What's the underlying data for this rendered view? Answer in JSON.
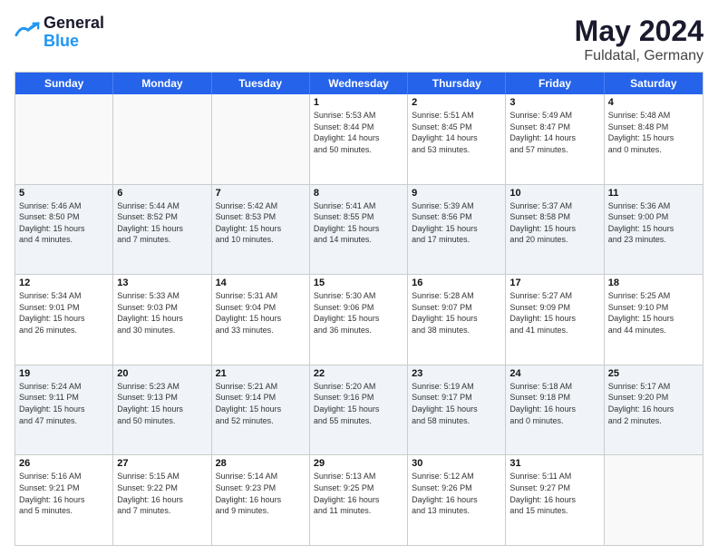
{
  "logo": {
    "line1": "General",
    "line2": "Blue"
  },
  "title": "May 2024",
  "subtitle": "Fuldatal, Germany",
  "dayHeaders": [
    "Sunday",
    "Monday",
    "Tuesday",
    "Wednesday",
    "Thursday",
    "Friday",
    "Saturday"
  ],
  "weeks": [
    [
      {
        "day": "",
        "info": ""
      },
      {
        "day": "",
        "info": ""
      },
      {
        "day": "",
        "info": ""
      },
      {
        "day": "1",
        "info": "Sunrise: 5:53 AM\nSunset: 8:44 PM\nDaylight: 14 hours\nand 50 minutes."
      },
      {
        "day": "2",
        "info": "Sunrise: 5:51 AM\nSunset: 8:45 PM\nDaylight: 14 hours\nand 53 minutes."
      },
      {
        "day": "3",
        "info": "Sunrise: 5:49 AM\nSunset: 8:47 PM\nDaylight: 14 hours\nand 57 minutes."
      },
      {
        "day": "4",
        "info": "Sunrise: 5:48 AM\nSunset: 8:48 PM\nDaylight: 15 hours\nand 0 minutes."
      }
    ],
    [
      {
        "day": "5",
        "info": "Sunrise: 5:46 AM\nSunset: 8:50 PM\nDaylight: 15 hours\nand 4 minutes."
      },
      {
        "day": "6",
        "info": "Sunrise: 5:44 AM\nSunset: 8:52 PM\nDaylight: 15 hours\nand 7 minutes."
      },
      {
        "day": "7",
        "info": "Sunrise: 5:42 AM\nSunset: 8:53 PM\nDaylight: 15 hours\nand 10 minutes."
      },
      {
        "day": "8",
        "info": "Sunrise: 5:41 AM\nSunset: 8:55 PM\nDaylight: 15 hours\nand 14 minutes."
      },
      {
        "day": "9",
        "info": "Sunrise: 5:39 AM\nSunset: 8:56 PM\nDaylight: 15 hours\nand 17 minutes."
      },
      {
        "day": "10",
        "info": "Sunrise: 5:37 AM\nSunset: 8:58 PM\nDaylight: 15 hours\nand 20 minutes."
      },
      {
        "day": "11",
        "info": "Sunrise: 5:36 AM\nSunset: 9:00 PM\nDaylight: 15 hours\nand 23 minutes."
      }
    ],
    [
      {
        "day": "12",
        "info": "Sunrise: 5:34 AM\nSunset: 9:01 PM\nDaylight: 15 hours\nand 26 minutes."
      },
      {
        "day": "13",
        "info": "Sunrise: 5:33 AM\nSunset: 9:03 PM\nDaylight: 15 hours\nand 30 minutes."
      },
      {
        "day": "14",
        "info": "Sunrise: 5:31 AM\nSunset: 9:04 PM\nDaylight: 15 hours\nand 33 minutes."
      },
      {
        "day": "15",
        "info": "Sunrise: 5:30 AM\nSunset: 9:06 PM\nDaylight: 15 hours\nand 36 minutes."
      },
      {
        "day": "16",
        "info": "Sunrise: 5:28 AM\nSunset: 9:07 PM\nDaylight: 15 hours\nand 38 minutes."
      },
      {
        "day": "17",
        "info": "Sunrise: 5:27 AM\nSunset: 9:09 PM\nDaylight: 15 hours\nand 41 minutes."
      },
      {
        "day": "18",
        "info": "Sunrise: 5:25 AM\nSunset: 9:10 PM\nDaylight: 15 hours\nand 44 minutes."
      }
    ],
    [
      {
        "day": "19",
        "info": "Sunrise: 5:24 AM\nSunset: 9:11 PM\nDaylight: 15 hours\nand 47 minutes."
      },
      {
        "day": "20",
        "info": "Sunrise: 5:23 AM\nSunset: 9:13 PM\nDaylight: 15 hours\nand 50 minutes."
      },
      {
        "day": "21",
        "info": "Sunrise: 5:21 AM\nSunset: 9:14 PM\nDaylight: 15 hours\nand 52 minutes."
      },
      {
        "day": "22",
        "info": "Sunrise: 5:20 AM\nSunset: 9:16 PM\nDaylight: 15 hours\nand 55 minutes."
      },
      {
        "day": "23",
        "info": "Sunrise: 5:19 AM\nSunset: 9:17 PM\nDaylight: 15 hours\nand 58 minutes."
      },
      {
        "day": "24",
        "info": "Sunrise: 5:18 AM\nSunset: 9:18 PM\nDaylight: 16 hours\nand 0 minutes."
      },
      {
        "day": "25",
        "info": "Sunrise: 5:17 AM\nSunset: 9:20 PM\nDaylight: 16 hours\nand 2 minutes."
      }
    ],
    [
      {
        "day": "26",
        "info": "Sunrise: 5:16 AM\nSunset: 9:21 PM\nDaylight: 16 hours\nand 5 minutes."
      },
      {
        "day": "27",
        "info": "Sunrise: 5:15 AM\nSunset: 9:22 PM\nDaylight: 16 hours\nand 7 minutes."
      },
      {
        "day": "28",
        "info": "Sunrise: 5:14 AM\nSunset: 9:23 PM\nDaylight: 16 hours\nand 9 minutes."
      },
      {
        "day": "29",
        "info": "Sunrise: 5:13 AM\nSunset: 9:25 PM\nDaylight: 16 hours\nand 11 minutes."
      },
      {
        "day": "30",
        "info": "Sunrise: 5:12 AM\nSunset: 9:26 PM\nDaylight: 16 hours\nand 13 minutes."
      },
      {
        "day": "31",
        "info": "Sunrise: 5:11 AM\nSunset: 9:27 PM\nDaylight: 16 hours\nand 15 minutes."
      },
      {
        "day": "",
        "info": ""
      }
    ]
  ]
}
